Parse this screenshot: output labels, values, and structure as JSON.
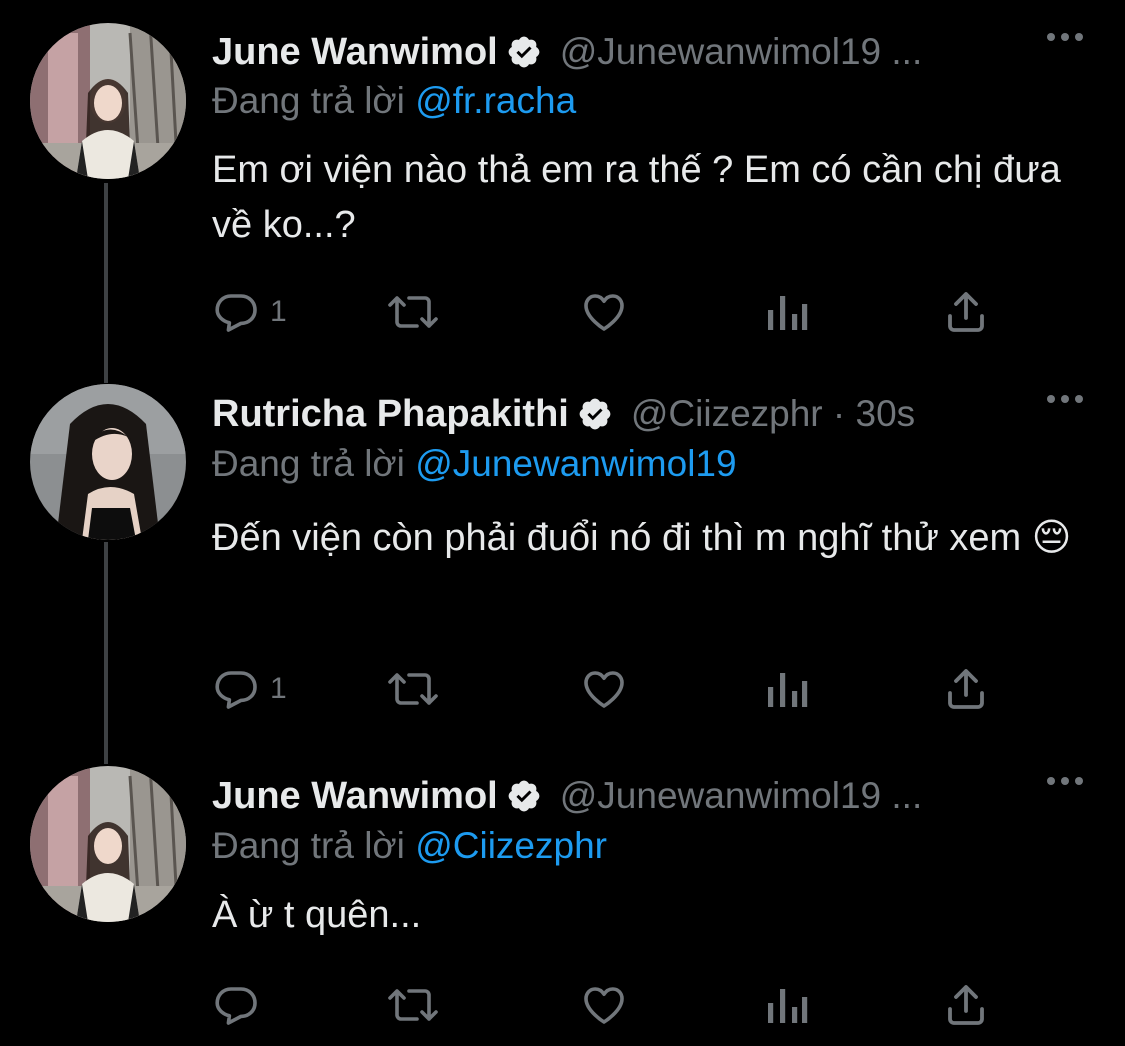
{
  "tweets": [
    {
      "name": "June Wanwimol",
      "handle": "@Junewanwimol19 ...",
      "replying_prefix": "Đang trả lời",
      "replying_to": "@fr.racha",
      "text": "Em ơi viện nào thả em ra thế ? Em có cần chị đưa về ko...?",
      "reply_count": "1"
    },
    {
      "name": "Rutricha Phapakithi",
      "handle": "@Ciizezphr · 30s",
      "replying_prefix": "Đang trả lời",
      "replying_to": "@Junewanwimol19",
      "text": "Đến viện còn phải đuổi nó đi thì m nghĩ thử xem 😔",
      "reply_count": "1"
    },
    {
      "name": "June Wanwimol",
      "handle": "@Junewanwimol19 ...",
      "replying_prefix": "Đang trả lời",
      "replying_to": "@Ciizezphr",
      "text": "À ừ t quên...",
      "reply_count": ""
    }
  ],
  "icons": {
    "verified": "verified-badge-icon",
    "more": "more-icon",
    "reply": "reply-icon",
    "retweet": "retweet-icon",
    "like": "like-icon",
    "views": "views-icon",
    "share": "share-icon"
  },
  "colors": {
    "background": "#000000",
    "text": "#e7e9ea",
    "muted": "#71767b",
    "link": "#1d9bf0",
    "thread_line": "#3e4144"
  }
}
